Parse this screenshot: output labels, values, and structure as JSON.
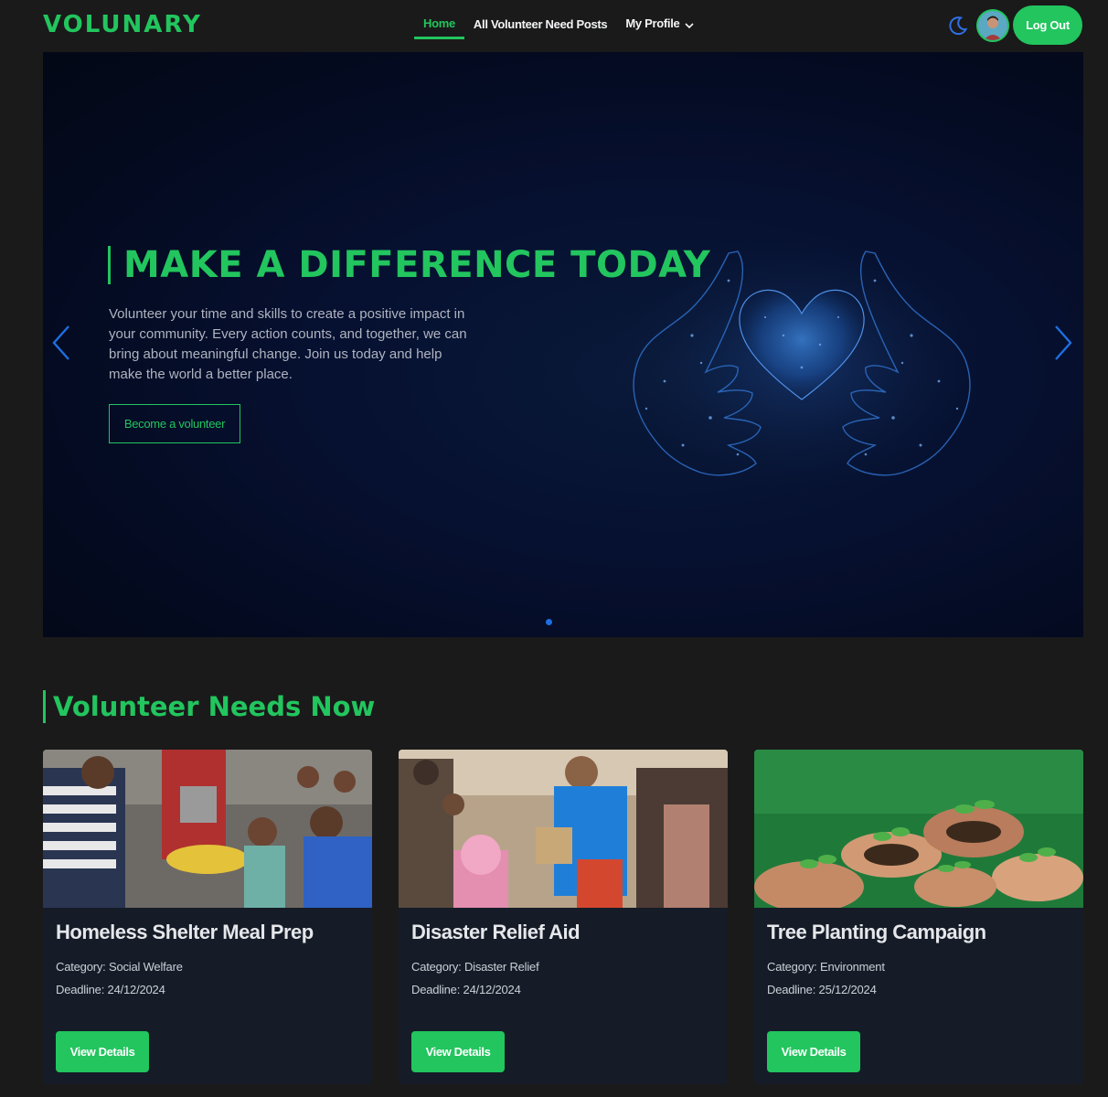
{
  "brand": "VOLUNARY",
  "nav": {
    "links": [
      "Home",
      "All Volunteer Need Posts",
      "My Profile"
    ],
    "active": "Home"
  },
  "header": {
    "logout_label": "Log Out"
  },
  "hero": {
    "title": "MAKE A DIFFERENCE TODAY",
    "description": "Volunteer your time and skills to create a positive impact in your community. Every action counts, and together, we can bring about meaningful change. Join us today and help make the world a better place.",
    "cta": "Become a volunteer",
    "slide_index": 1,
    "slide_count": 1
  },
  "section": {
    "title": "Volunteer Needs Now"
  },
  "cards": [
    {
      "title": "Homeless Shelter Meal Prep",
      "category": "Category: Social Welfare",
      "deadline": "Deadline: 24/12/2024",
      "button": "View Details"
    },
    {
      "title": "Disaster Relief Aid",
      "category": "Category: Disaster Relief",
      "deadline": "Deadline: 24/12/2024",
      "button": "View Details"
    },
    {
      "title": "Tree Planting Campaign",
      "category": "Category: Environment",
      "deadline": "Deadline: 25/12/2024",
      "button": "View Details"
    }
  ],
  "colors": {
    "accent": "#22c55e",
    "background": "#1a1a1a",
    "card": "#151c27",
    "hero": "#040a1f",
    "arrow": "#1d6fe0"
  },
  "icons": [
    "moon-icon",
    "chevron-down-icon",
    "chevron-left-icon",
    "chevron-right-icon",
    "heart-hands-illustration"
  ]
}
